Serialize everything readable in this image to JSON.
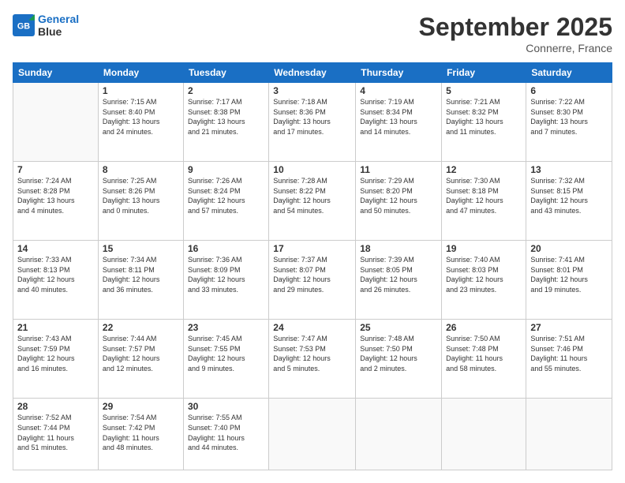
{
  "header": {
    "logo_line1": "General",
    "logo_line2": "Blue",
    "month": "September 2025",
    "location": "Connerre, France"
  },
  "weekdays": [
    "Sunday",
    "Monday",
    "Tuesday",
    "Wednesday",
    "Thursday",
    "Friday",
    "Saturday"
  ],
  "weeks": [
    [
      {
        "day": "",
        "info": ""
      },
      {
        "day": "1",
        "info": "Sunrise: 7:15 AM\nSunset: 8:40 PM\nDaylight: 13 hours\nand 24 minutes."
      },
      {
        "day": "2",
        "info": "Sunrise: 7:17 AM\nSunset: 8:38 PM\nDaylight: 13 hours\nand 21 minutes."
      },
      {
        "day": "3",
        "info": "Sunrise: 7:18 AM\nSunset: 8:36 PM\nDaylight: 13 hours\nand 17 minutes."
      },
      {
        "day": "4",
        "info": "Sunrise: 7:19 AM\nSunset: 8:34 PM\nDaylight: 13 hours\nand 14 minutes."
      },
      {
        "day": "5",
        "info": "Sunrise: 7:21 AM\nSunset: 8:32 PM\nDaylight: 13 hours\nand 11 minutes."
      },
      {
        "day": "6",
        "info": "Sunrise: 7:22 AM\nSunset: 8:30 PM\nDaylight: 13 hours\nand 7 minutes."
      }
    ],
    [
      {
        "day": "7",
        "info": "Sunrise: 7:24 AM\nSunset: 8:28 PM\nDaylight: 13 hours\nand 4 minutes."
      },
      {
        "day": "8",
        "info": "Sunrise: 7:25 AM\nSunset: 8:26 PM\nDaylight: 13 hours\nand 0 minutes."
      },
      {
        "day": "9",
        "info": "Sunrise: 7:26 AM\nSunset: 8:24 PM\nDaylight: 12 hours\nand 57 minutes."
      },
      {
        "day": "10",
        "info": "Sunrise: 7:28 AM\nSunset: 8:22 PM\nDaylight: 12 hours\nand 54 minutes."
      },
      {
        "day": "11",
        "info": "Sunrise: 7:29 AM\nSunset: 8:20 PM\nDaylight: 12 hours\nand 50 minutes."
      },
      {
        "day": "12",
        "info": "Sunrise: 7:30 AM\nSunset: 8:18 PM\nDaylight: 12 hours\nand 47 minutes."
      },
      {
        "day": "13",
        "info": "Sunrise: 7:32 AM\nSunset: 8:15 PM\nDaylight: 12 hours\nand 43 minutes."
      }
    ],
    [
      {
        "day": "14",
        "info": "Sunrise: 7:33 AM\nSunset: 8:13 PM\nDaylight: 12 hours\nand 40 minutes."
      },
      {
        "day": "15",
        "info": "Sunrise: 7:34 AM\nSunset: 8:11 PM\nDaylight: 12 hours\nand 36 minutes."
      },
      {
        "day": "16",
        "info": "Sunrise: 7:36 AM\nSunset: 8:09 PM\nDaylight: 12 hours\nand 33 minutes."
      },
      {
        "day": "17",
        "info": "Sunrise: 7:37 AM\nSunset: 8:07 PM\nDaylight: 12 hours\nand 29 minutes."
      },
      {
        "day": "18",
        "info": "Sunrise: 7:39 AM\nSunset: 8:05 PM\nDaylight: 12 hours\nand 26 minutes."
      },
      {
        "day": "19",
        "info": "Sunrise: 7:40 AM\nSunset: 8:03 PM\nDaylight: 12 hours\nand 23 minutes."
      },
      {
        "day": "20",
        "info": "Sunrise: 7:41 AM\nSunset: 8:01 PM\nDaylight: 12 hours\nand 19 minutes."
      }
    ],
    [
      {
        "day": "21",
        "info": "Sunrise: 7:43 AM\nSunset: 7:59 PM\nDaylight: 12 hours\nand 16 minutes."
      },
      {
        "day": "22",
        "info": "Sunrise: 7:44 AM\nSunset: 7:57 PM\nDaylight: 12 hours\nand 12 minutes."
      },
      {
        "day": "23",
        "info": "Sunrise: 7:45 AM\nSunset: 7:55 PM\nDaylight: 12 hours\nand 9 minutes."
      },
      {
        "day": "24",
        "info": "Sunrise: 7:47 AM\nSunset: 7:53 PM\nDaylight: 12 hours\nand 5 minutes."
      },
      {
        "day": "25",
        "info": "Sunrise: 7:48 AM\nSunset: 7:50 PM\nDaylight: 12 hours\nand 2 minutes."
      },
      {
        "day": "26",
        "info": "Sunrise: 7:50 AM\nSunset: 7:48 PM\nDaylight: 11 hours\nand 58 minutes."
      },
      {
        "day": "27",
        "info": "Sunrise: 7:51 AM\nSunset: 7:46 PM\nDaylight: 11 hours\nand 55 minutes."
      }
    ],
    [
      {
        "day": "28",
        "info": "Sunrise: 7:52 AM\nSunset: 7:44 PM\nDaylight: 11 hours\nand 51 minutes."
      },
      {
        "day": "29",
        "info": "Sunrise: 7:54 AM\nSunset: 7:42 PM\nDaylight: 11 hours\nand 48 minutes."
      },
      {
        "day": "30",
        "info": "Sunrise: 7:55 AM\nSunset: 7:40 PM\nDaylight: 11 hours\nand 44 minutes."
      },
      {
        "day": "",
        "info": ""
      },
      {
        "day": "",
        "info": ""
      },
      {
        "day": "",
        "info": ""
      },
      {
        "day": "",
        "info": ""
      }
    ]
  ]
}
